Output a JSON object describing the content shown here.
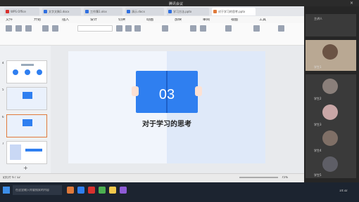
{
  "window": {
    "title": "腾讯会议"
  },
  "tabs": [
    {
      "label": "WPS Office",
      "color": "#d9312e"
    },
    {
      "label": "文字文稿1.docx",
      "color": "#2f6fe0"
    },
    {
      "label": "工作簿1.xlsx",
      "color": "#2f6fe0"
    },
    {
      "label": "演示.docx",
      "color": "#2f6fe0"
    },
    {
      "label": "学习方法.pptx",
      "color": "#2f6fe0"
    },
    {
      "label": "对于学习的思考.pptx",
      "color": "#e07a3b"
    }
  ],
  "menu": [
    "文件",
    "开始",
    "插入",
    "设计",
    "切换",
    "动画",
    "放映",
    "审阅",
    "视图",
    "工具"
  ],
  "slide": {
    "number": "03",
    "title": "对于学习的思考"
  },
  "thumbnails": [
    {
      "index": "4"
    },
    {
      "index": "5"
    },
    {
      "index": "6"
    },
    {
      "index": "7"
    }
  ],
  "notes": {
    "placeholder": "单击此处添加备注"
  },
  "status": {
    "slide_info": "幻灯片 6 / 12",
    "zoom": "75%"
  },
  "participants": [
    {
      "name": "主讲人"
    },
    {
      "name": "学生1"
    },
    {
      "name": "学生2"
    },
    {
      "name": "学生3"
    },
    {
      "name": "学生4"
    },
    {
      "name": "学生5"
    },
    {
      "name": "学生6"
    }
  ],
  "taskbar": {
    "search": "在这里输入你要搜索的内容",
    "time": "14:32"
  },
  "colors": {
    "accent_blue": "#2f7ff0",
    "accent_orange": "#e07a3b"
  }
}
